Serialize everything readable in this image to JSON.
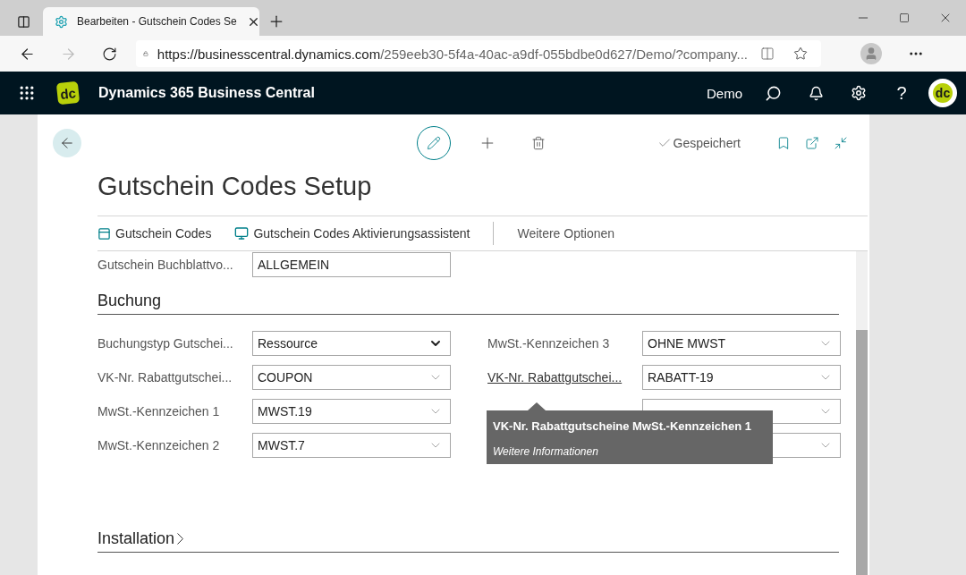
{
  "browser": {
    "tab": {
      "title": "Bearbeiten - Gutschein Codes Se",
      "selected": true
    },
    "url_host": "https://businesscentral.dynamics.com",
    "url_path": "/259eeb30-5f4a-40ac-a9df-055bdbe0d627/Demo/?company..."
  },
  "app_bar": {
    "logo_text": "dc",
    "product": "Dynamics 365 Business Central",
    "company": "Demo",
    "help": "?",
    "avatar_text": "dc"
  },
  "page": {
    "title": "Gutschein Codes Setup",
    "status": "Gespeichert",
    "actions": [
      {
        "label": "Gutschein Codes",
        "kind": "list"
      },
      {
        "label": "Gutschein Codes Aktivierungsassistent",
        "kind": "wizard"
      },
      {
        "label": "Weitere Optionen",
        "kind": "more"
      }
    ],
    "partial_row": {
      "label": "Gutschein Buchblattvo...",
      "value": "ALLGEMEIN"
    },
    "sections": [
      {
        "title": "Buchung",
        "expanded": true,
        "left": [
          {
            "label": "Buchungstyp Gutschei...",
            "value": "Ressource",
            "kind": "select",
            "hovered": false
          },
          {
            "label": "VK-Nr. Rabattgutschei...",
            "value": "COUPON",
            "kind": "lookup",
            "hovered": false
          },
          {
            "label": "MwSt.-Kennzeichen 1",
            "value": "MWST.19",
            "kind": "lookup",
            "hovered": false
          },
          {
            "label": "MwSt.-Kennzeichen 2",
            "value": "MWST.7",
            "kind": "lookup",
            "hovered": false
          }
        ],
        "right": [
          {
            "label": "MwSt.-Kennzeichen 3",
            "value": "OHNE MWST",
            "kind": "lookup",
            "hovered": false
          },
          {
            "label": "VK-Nr. Rabattgutschei...",
            "value": "RABATT-19",
            "kind": "lookup",
            "hovered": true
          },
          {
            "kind": "lookup"
          },
          {
            "kind": "lookup"
          }
        ]
      },
      {
        "title": "Installation",
        "expanded": false
      }
    ],
    "tooltip": {
      "title": "VK-Nr. Rabattgutscheine MwSt.-Kennzeichen 1",
      "link": "Weitere Informationen"
    }
  }
}
